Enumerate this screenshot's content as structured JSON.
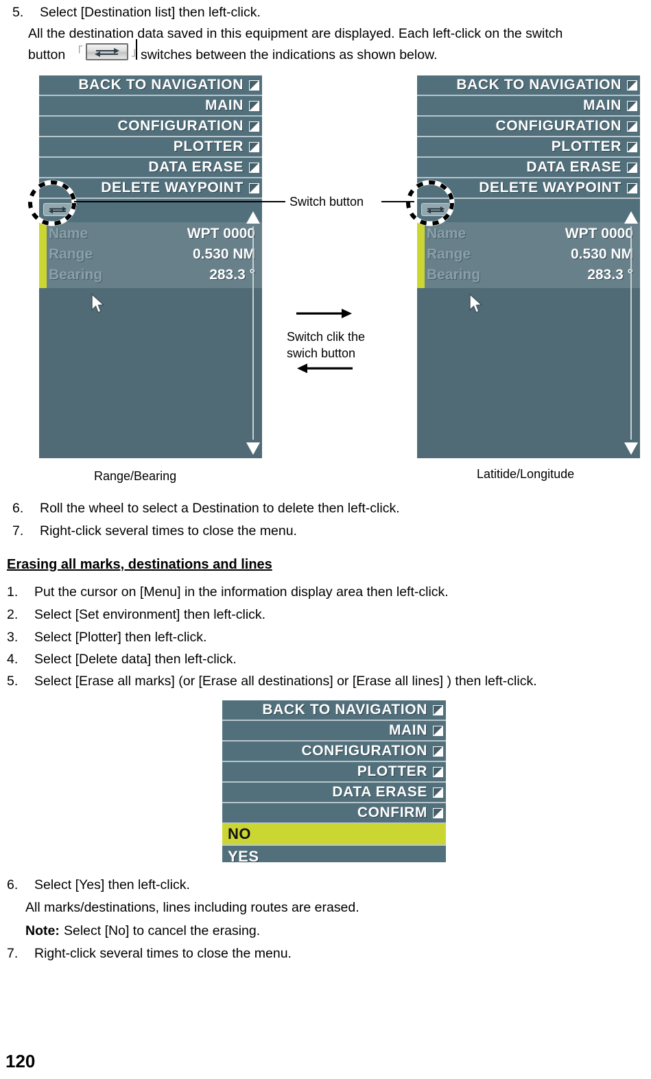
{
  "page": {
    "number": "120"
  },
  "steps_top": [
    {
      "num": "5.",
      "text": "Select [Destination list] then left-click."
    }
  ],
  "intro": {
    "line1": "All the destination data saved in this equipment are displayed. Each left-click on the switch",
    "line2_pre": "button",
    "bracket_open": "「",
    "bracket_close": "」",
    "inline_icon": "switch-button-icon",
    "line2_post": "switches between the indications as shown below."
  },
  "device_menu": {
    "items": [
      {
        "label": "BACK TO NAVIGATION"
      },
      {
        "label": "MAIN"
      },
      {
        "label": "CONFIGURATION"
      },
      {
        "label": "PLOTTER"
      },
      {
        "label": "DATA ERASE"
      },
      {
        "label": "DELETE WAYPOINT"
      }
    ],
    "switch_button_icon": "switch-button-icon",
    "data_rows": [
      {
        "key": "Name",
        "value": "WPT 0000"
      },
      {
        "key": "Range",
        "value": "0.530 NM"
      },
      {
        "key": "Bearing",
        "value": "283.3 °"
      }
    ],
    "colors": {
      "background": "#506b76",
      "row": "#51707c",
      "divider": "#b9c6cb",
      "accent": "#ccd633",
      "text": "#ffffff",
      "key_text": "#8ba0a8"
    }
  },
  "callouts": {
    "switch_button": "Switch button",
    "switch_click": "Switch clik the\nswich button",
    "switch_click_line1": "Switch clik the",
    "switch_click_line2": "swich button"
  },
  "captions": {
    "left": "Range/Bearing",
    "right": "Latitide/Longitude"
  },
  "steps_mid": [
    {
      "num": "6.",
      "text": "Roll the wheel to select a Destination to delete then left-click."
    },
    {
      "num": "7.",
      "text": "Right-click several times to close the menu."
    }
  ],
  "section": {
    "heading": "Erasing all marks, destinations and lines"
  },
  "steps_erase": [
    {
      "num": "1.",
      "text": "Put the cursor on [Menu] in the information display area then left-click."
    },
    {
      "num": "2.",
      "text": "Select [Set environment] then left-click."
    },
    {
      "num": "3.",
      "text": "Select [Plotter] then left-click."
    },
    {
      "num": "4.",
      "text": "Select [Delete data] then left-click."
    },
    {
      "num": "5.",
      "text": "Select [Erase all marks] (or [Erase all destinations] or [Erase all lines] ) then left-click."
    }
  ],
  "confirm_menu": {
    "items": [
      {
        "label": "BACK TO NAVIGATION"
      },
      {
        "label": "MAIN"
      },
      {
        "label": "CONFIGURATION"
      },
      {
        "label": "PLOTTER"
      },
      {
        "label": "DATA ERASE"
      },
      {
        "label": "CONFIRM"
      }
    ],
    "options": [
      {
        "label": "NO",
        "selected": true
      },
      {
        "label": "YES",
        "selected": false
      }
    ],
    "selected_color": "#ccd633"
  },
  "steps_bottom": [
    {
      "num": "6.",
      "text": "Select [Yes] then left-click."
    }
  ],
  "bottom_notes": {
    "line1": "All marks/destinations, lines including routes are erased.",
    "note_label": "Note:",
    "note_text": "Select [No] to cancel the erasing.",
    "last_num": "7.",
    "last_text": "Right-click several times to close the menu."
  }
}
